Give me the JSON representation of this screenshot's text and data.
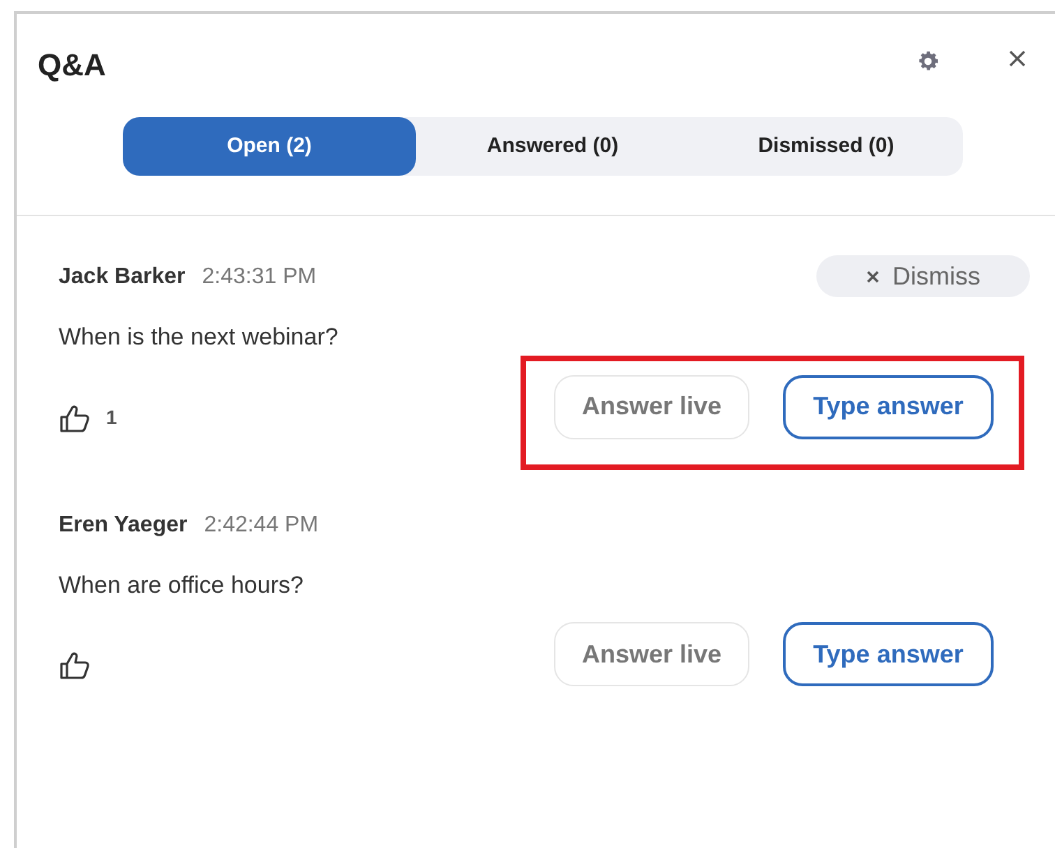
{
  "panel": {
    "title": "Q&A"
  },
  "tabs": [
    {
      "label": "Open (2)",
      "selected": true
    },
    {
      "label": "Answered (0)",
      "selected": false
    },
    {
      "label": "Dismissed (0)",
      "selected": false
    }
  ],
  "questions": [
    {
      "name": "Jack Barker",
      "time": "2:43:31 PM",
      "text": "When is the next webinar?",
      "likes": "1",
      "dismiss": "Dismiss",
      "highlighted": true,
      "actions": [
        {
          "label": "Answer live",
          "kind": "secondary"
        },
        {
          "label": "Type answer",
          "kind": "primary"
        }
      ]
    },
    {
      "name": "Eren Yaeger",
      "time": "2:42:44 PM",
      "text": "When are office hours?",
      "highlighted": false,
      "actions": [
        {
          "label": "Answer live",
          "kind": "secondary"
        },
        {
          "label": "Type answer",
          "kind": "primary"
        }
      ]
    }
  ]
}
